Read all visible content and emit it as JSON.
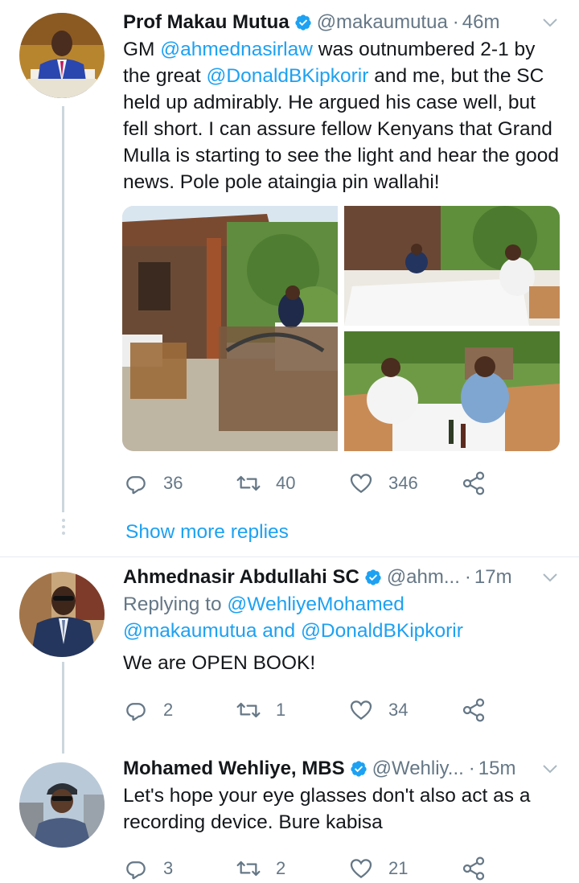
{
  "tweets": [
    {
      "display_name": "Prof Makau Mutua",
      "handle": "@makaumutua",
      "time": "46m",
      "text_parts": [
        "GM ",
        "@ahmednasirlaw",
        " was outnumbered 2-1 by the great ",
        "@DonaldBKipkorir",
        " and me, but the SC held up admirably.  He argued his case well, but fell short.  I can assure fellow Kenyans that Grand Mulla is starting to see the light and hear the good news.  Pole pole ataingia pin wallahi!"
      ],
      "replies": "36",
      "retweets": "40",
      "likes": "346"
    },
    {
      "display_name": "Ahmednasir Abdullahi SC",
      "handle": "@ahm...",
      "time": "17m",
      "replying_prefix": "Replying to ",
      "replying_to_1": "@WehliyeMohamed",
      "replying_to_2": "@makaumutua",
      "replying_and": " and ",
      "replying_to_3": "@DonaldBKipkorir",
      "text": "We are OPEN BOOK!",
      "replies": "2",
      "retweets": "1",
      "likes": "34"
    },
    {
      "display_name": "Mohamed Wehliye, MBS",
      "handle": "@Wehliy...",
      "time": "15m",
      "text": "Let's hope your eye glasses don't also act as a recording device. Bure kabisa",
      "replies": "3",
      "retweets": "2",
      "likes": "21"
    }
  ],
  "show_more_replies": "Show more replies",
  "separator": "·",
  "icons": {
    "reply": "reply-icon",
    "retweet": "retweet-icon",
    "like": "heart-icon",
    "share": "share-icon",
    "verified": "verified-badge-icon",
    "caret": "chevron-down-icon"
  },
  "colors": {
    "accent": "#1da1f2",
    "muted": "#657786",
    "text": "#14171a",
    "thread": "#ccd6dd"
  }
}
